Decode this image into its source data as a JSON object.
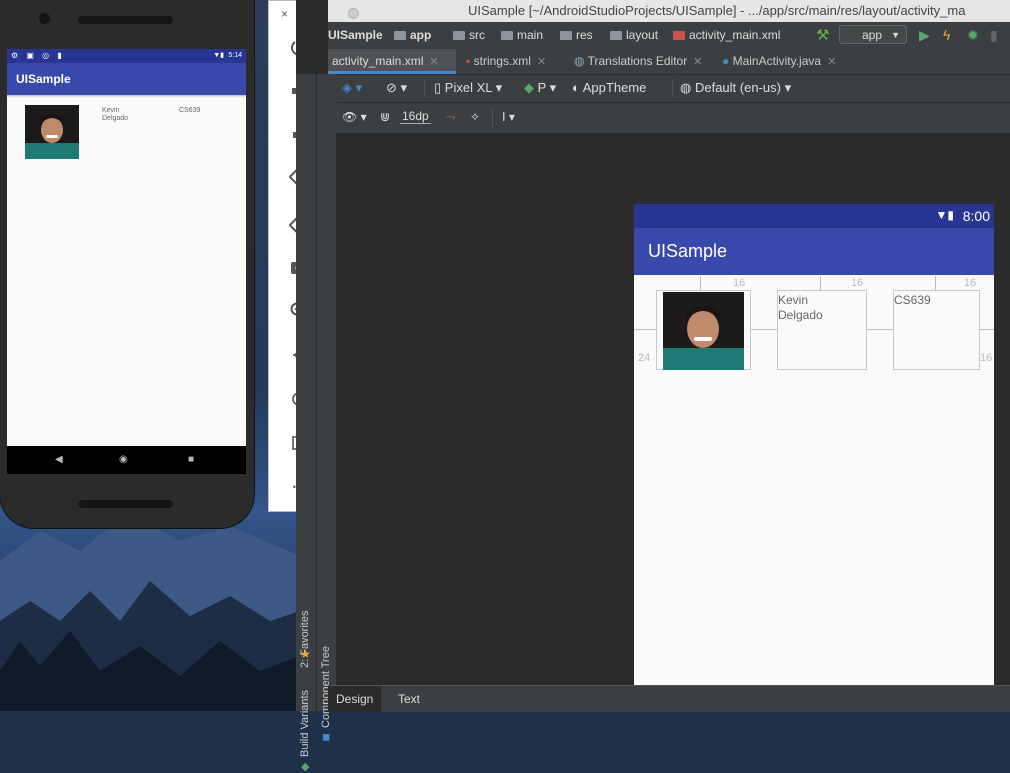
{
  "emulator": {
    "status_time": "5:14",
    "app_title": "UISample",
    "contact_name": "Kevin\nDelgado",
    "course_code": "CS639"
  },
  "emulator_toolbar": {
    "close": "×",
    "minimize": "–",
    "more": "•••"
  },
  "studio": {
    "window_title": "UISample [~/AndroidStudioProjects/UISample] - .../app/src/main/res/layout/activity_ma",
    "breadcrumbs": [
      "UISample",
      "app",
      "src",
      "main",
      "res",
      "layout",
      "activity_main.xml"
    ],
    "run_config": "app",
    "tabs": [
      {
        "label": "activity_main.xml",
        "active": true
      },
      {
        "label": "strings.xml",
        "active": false
      },
      {
        "label": "Translations Editor",
        "active": false
      },
      {
        "label": "MainActivity.java",
        "active": false
      }
    ],
    "toolbar": {
      "device": "Pixel XL",
      "api": "P",
      "theme": "AppTheme",
      "locale": "Default (en-us)",
      "margin": "16dp"
    },
    "side_tabs": {
      "favorites": "2: Favorites",
      "build_variants": "Build Variants",
      "component_tree": "Component Tree"
    },
    "bottom_tabs": [
      "Design",
      "Text"
    ],
    "preview": {
      "time": "8:00",
      "app_title": "UISample",
      "name_text": "Kevin\nDelgado",
      "course_text": "CS639",
      "margin_top_1": "16",
      "margin_top_2": "16",
      "margin_top_3": "16",
      "margin_left": "24",
      "margin_right": "16"
    }
  }
}
